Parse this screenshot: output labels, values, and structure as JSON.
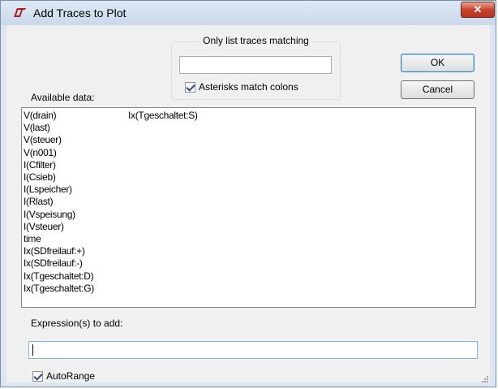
{
  "window": {
    "title": "Add Traces to Plot",
    "close_label": "✕"
  },
  "filter": {
    "legend": "Only list traces matching",
    "value": "",
    "asterisks_label": "Asterisks match colons",
    "asterisks_checked": true
  },
  "buttons": {
    "ok_label": "OK",
    "cancel_label": "Cancel"
  },
  "available": {
    "label": "Available data:",
    "column1": [
      "V(drain)",
      "V(last)",
      "V(steuer)",
      "V(n001)",
      "I(Cfilter)",
      "I(Csieb)",
      "I(Lspeicher)",
      "I(Rlast)",
      "I(Vspeisung)",
      "I(Vsteuer)",
      "time",
      "Ix(SDfreilauf:+)",
      "Ix(SDfreilauf:-)",
      "Ix(Tgeschaltet:D)",
      "Ix(Tgeschaltet:G)"
    ],
    "column2": [
      "Ix(Tgeschaltet:S)"
    ]
  },
  "expression": {
    "label": "Expression(s) to add:",
    "value": ""
  },
  "autorange": {
    "label": "AutoRange",
    "checked": true
  }
}
